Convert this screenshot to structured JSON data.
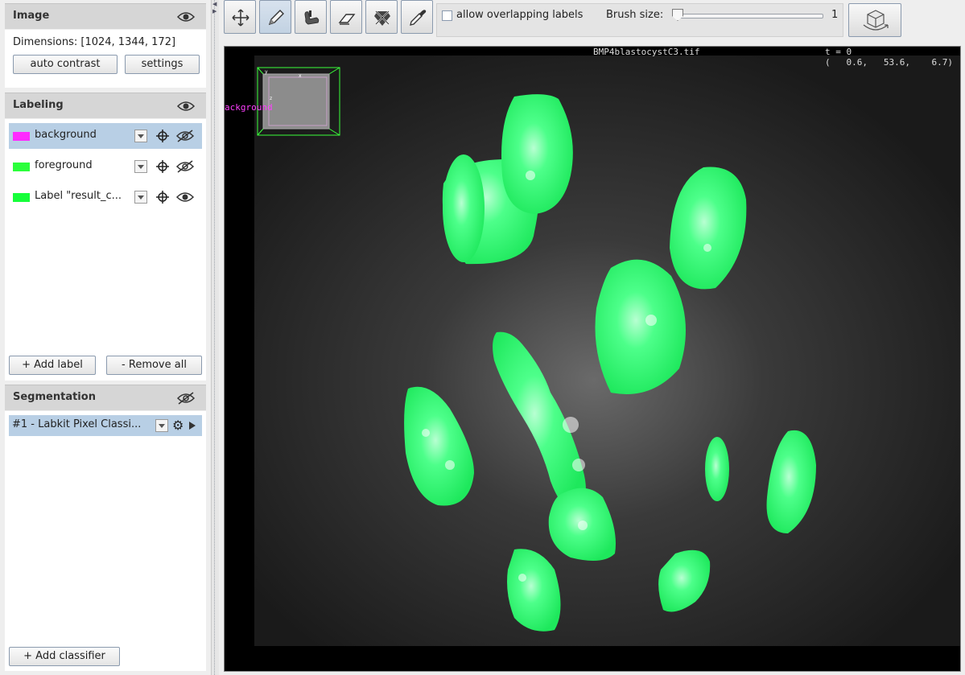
{
  "image_panel": {
    "title": "Image",
    "dimensions": "Dimensions: [1024, 1344, 172]",
    "auto_contrast": "auto contrast",
    "settings": "settings"
  },
  "labeling_panel": {
    "title": "Labeling",
    "labels": [
      {
        "name": "background",
        "color": "#ff2bff",
        "visible": false,
        "selected": true
      },
      {
        "name": "foreground",
        "color": "#2bff3b",
        "visible": false,
        "selected": false
      },
      {
        "name": "Label \"result_c...",
        "color": "#16ff3a",
        "visible": true,
        "selected": false
      }
    ],
    "add_label": "+ Add label",
    "remove_all": "-  Remove all"
  },
  "segmentation_panel": {
    "title": "Segmentation",
    "item": "#1 - Labkit Pixel Classi...",
    "add_classifier": "+ Add classifier"
  },
  "toolbar": {
    "tools": [
      "move-icon",
      "pencil-icon",
      "flood-fill-icon",
      "eraser-icon",
      "remove-label-icon",
      "picker-icon"
    ],
    "active_tool": "pencil-icon",
    "allow_overlap": "allow overlapping labels",
    "brush_label": "Brush size:",
    "brush_value": "1"
  },
  "viewer": {
    "image_title": "BMP4blastocystC3.tif",
    "time": "t = 0",
    "coords": "(   0.6,   53.6,    6.7)",
    "overlay_label": "ackground"
  },
  "colors": {
    "accent_selection": "#b8cfe5",
    "mask_green": "#2bff6a"
  }
}
